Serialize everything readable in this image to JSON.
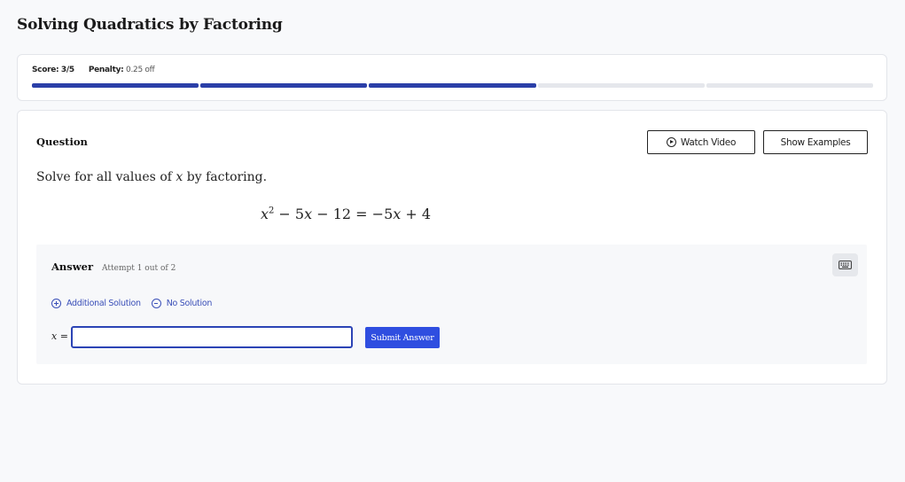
{
  "page": {
    "title": "Solving Quadratics by Factoring"
  },
  "score": {
    "score_label": "Score:",
    "score_value": "3/5",
    "penalty_label": "Penalty:",
    "penalty_value": "0.25 off",
    "progress": {
      "completed": 3,
      "total": 5
    },
    "colors": {
      "done": "#2b3fa8",
      "remaining": "#e5e7ec"
    }
  },
  "question": {
    "label": "Question",
    "watch_video_label": "Watch Video",
    "show_examples_label": "Show Examples",
    "prompt_before": "Solve for all values of ",
    "prompt_var": "x",
    "prompt_after": " by factoring.",
    "equation": {
      "lhs": [
        "x",
        "2",
        " − 5",
        "x",
        " − 12"
      ],
      "rhs": [
        "−5",
        "x",
        " + 4"
      ]
    }
  },
  "answer": {
    "title": "Answer",
    "attempt": "Attempt 1 out of 2",
    "additional_solution_label": "Additional Solution",
    "no_solution_label": "No Solution",
    "var_label": "x",
    "input_value": "",
    "submit_label": "Submit Answer",
    "accent": "#2f4ee0"
  }
}
